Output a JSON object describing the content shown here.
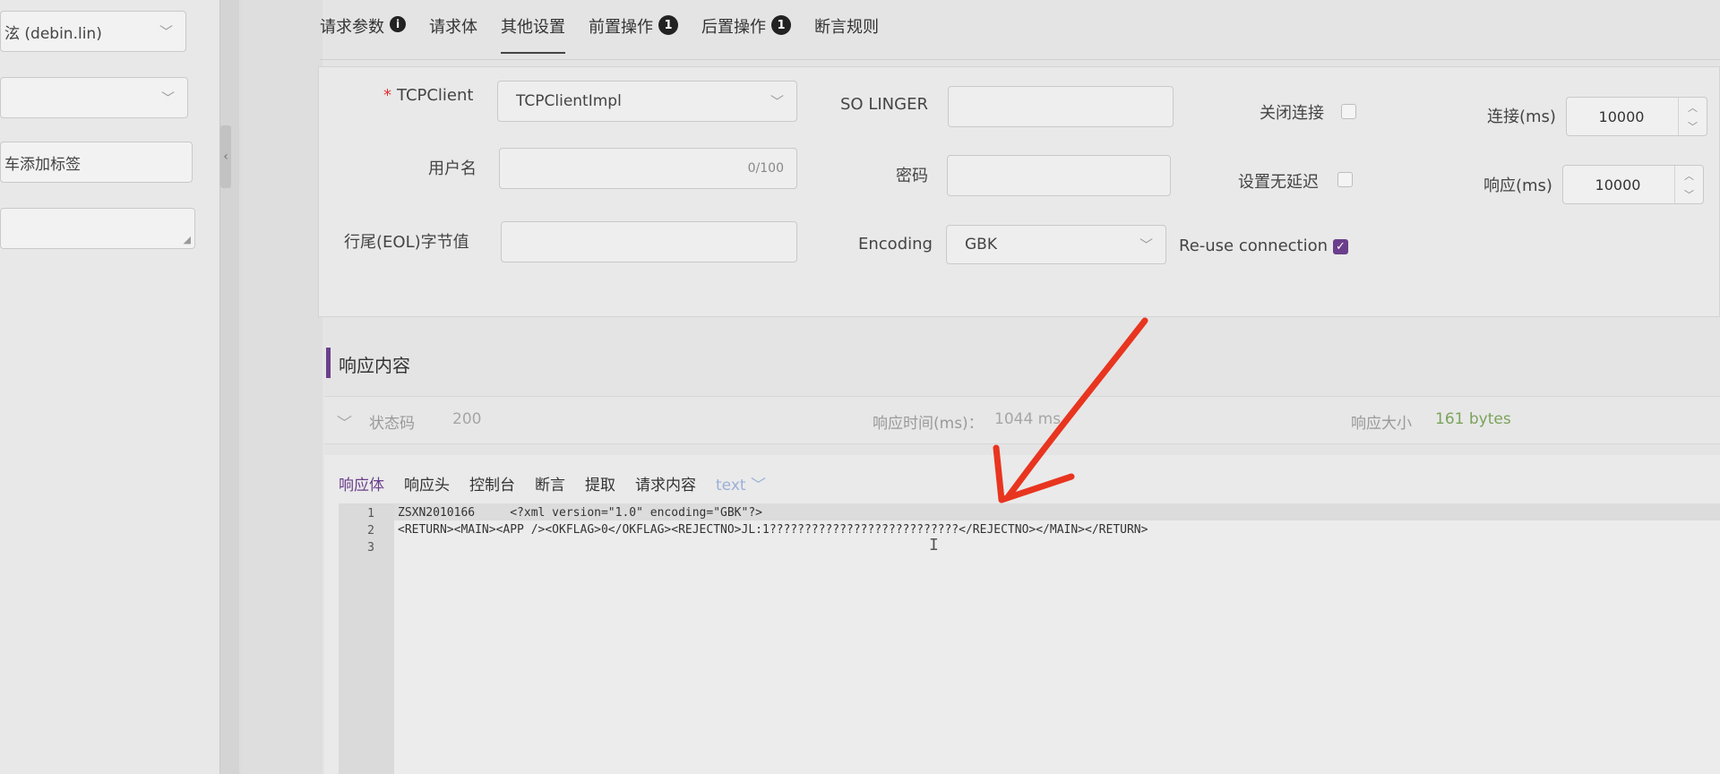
{
  "sidebar": {
    "field1_value": "泫 (debin.lin)",
    "field2_value": "",
    "tag_field_value": "车添加标签",
    "textarea_value": ""
  },
  "tabs": [
    {
      "label": "请求参数",
      "info": "i"
    },
    {
      "label": "请求体"
    },
    {
      "label": "其他设置",
      "active": true
    },
    {
      "label": "前置操作",
      "badge": "1"
    },
    {
      "label": "后置操作",
      "badge": "1"
    },
    {
      "label": "断言规则"
    }
  ],
  "settings": {
    "tcpclient_label": "TCPClient",
    "tcpclient_required_mark": "*",
    "tcpclient_value": "TCPClientImpl",
    "so_linger_label": "SO LINGER",
    "so_linger_value": "",
    "close_conn_label": "关闭连接",
    "close_conn_checked": false,
    "connect_label": "连接(ms)",
    "connect_value": "10000",
    "username_label": "用户名",
    "username_value": "",
    "username_counter": "0/100",
    "password_label": "密码",
    "password_value": "",
    "no_delay_label": "设置无延迟",
    "no_delay_checked": false,
    "response_ms_label": "响应(ms)",
    "response_ms_value": "10000",
    "eol_label": "行尾(EOL)字节值",
    "eol_value": "",
    "encoding_label": "Encoding",
    "encoding_value": "GBK",
    "reuse_label": "Re-use connection",
    "reuse_checked": true
  },
  "response": {
    "title": "响应内容",
    "status_label": "状态码",
    "status_value": "200",
    "time_label": "响应时间(ms)：",
    "time_value": "1044 ms",
    "size_label": "响应大小",
    "size_value": "161 bytes",
    "tabs": [
      "响应体",
      "响应头",
      "控制台",
      "断言",
      "提取",
      "请求内容"
    ],
    "format_select": "text",
    "lines": [
      {
        "no": "1",
        "text": "ZSXN2010166     <?xml version=\"1.0\" encoding=\"GBK\"?>"
      },
      {
        "no": "2",
        "text": "<RETURN><MAIN><APP /><OKFLAG>0</OKFLAG><REJECTNO>JL:1???????????????????????????</REJECTNO></MAIN></RETURN>"
      },
      {
        "no": "3",
        "text": ""
      }
    ]
  },
  "icons": {
    "chevron_down": "chevron-down-icon",
    "info": "info-icon",
    "check": "check-icon",
    "text_cursor": "text-cursor-icon",
    "annotation_arrow": "red-arrow-annotation"
  },
  "colors": {
    "accent": "#6b3f8c",
    "success": "#7aa35a",
    "annotation": "#e8351f"
  }
}
